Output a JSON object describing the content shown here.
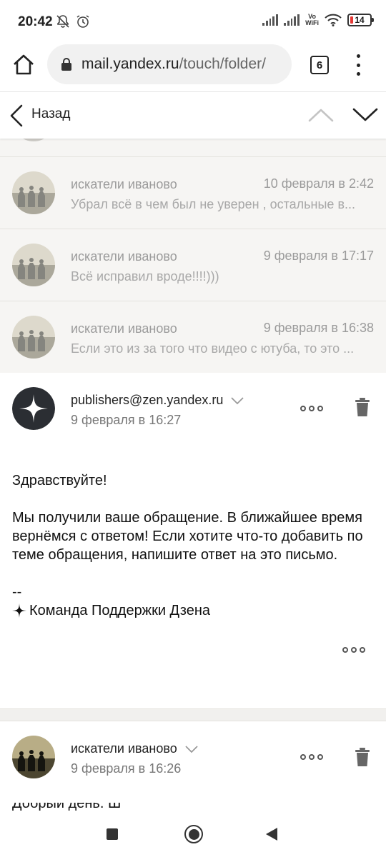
{
  "status_bar": {
    "time": "20:42",
    "vowifi_top": "Vo",
    "vowifi_bottom": "WiFi",
    "battery": "14"
  },
  "browser": {
    "url_domain": "mail.yandex.ru",
    "url_path": "/touch/folder/",
    "tab_count": "6"
  },
  "nav": {
    "back_label": "Назад"
  },
  "thread": [
    {
      "sender": "искатели иваново",
      "date": "10 февраля в 2:42",
      "snippet": "Убрал всё в чем был не уверен , остальные в..."
    },
    {
      "sender": "искатели иваново",
      "date": "9 февраля в 17:17",
      "snippet": "Всё исправил вроде!!!!)))"
    },
    {
      "sender": "искатели иваново",
      "date": "9 февраля в 16:38",
      "snippet": "Если это из за того что видео с ютуба, то это ..."
    }
  ],
  "message_1": {
    "from": "publishers@zen.yandex.ru",
    "date": "9 февраля в 16:27",
    "greeting": "Здравствуйте!",
    "body": "Мы получили ваше обращение. В ближайшее время вернёмся с ответом! Если хотите что-то добавить по теме обращения, напишите ответ на это письмо.",
    "sig_dash": "--",
    "signature": "Команда Поддержки Дзена"
  },
  "message_2": {
    "from": "искатели иваново",
    "date": "9 февраля в 16:26",
    "body_partial": "Добрый день. Ш"
  },
  "colors": {
    "thread_bg": "#f6f5f3",
    "muted_text": "#9b9b9b",
    "zen_logo_bg": "#2b2e33"
  }
}
